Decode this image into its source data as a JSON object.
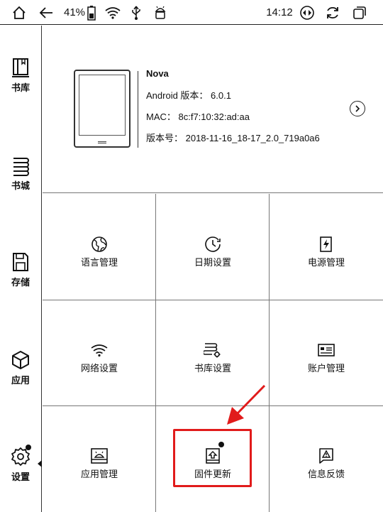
{
  "status_bar": {
    "battery": "41%",
    "time": "14:12",
    "icons": [
      "home-icon",
      "back-icon",
      "battery-icon",
      "wifi-icon",
      "usb-icon",
      "android-icon",
      "rotate-icon",
      "refresh-icon",
      "multitask-icon"
    ]
  },
  "sidebar": {
    "items": [
      {
        "label": "书库",
        "icon": "bookshelf-icon"
      },
      {
        "label": "书城",
        "icon": "bookstore-icon"
      },
      {
        "label": "存储",
        "icon": "storage-icon"
      },
      {
        "label": "应用",
        "icon": "apps-icon"
      },
      {
        "label": "设置",
        "icon": "settings-icon"
      }
    ],
    "active": "设置"
  },
  "device": {
    "name": "Nova",
    "android_line": "Android 版本： 6.0.1",
    "mac_line": "MAC： 8c:f7:10:32:ad:aa",
    "build_line": "版本号： 2018-11-16_18-17_2.0_719a0a6"
  },
  "tiles": [
    {
      "label": "语言管理",
      "icon": "globe-icon"
    },
    {
      "label": "日期设置",
      "icon": "clock-icon"
    },
    {
      "label": "电源管理",
      "icon": "power-icon"
    },
    {
      "label": "网络设置",
      "icon": "wifi-icon"
    },
    {
      "label": "书库设置",
      "icon": "library-settings-icon"
    },
    {
      "label": "账户管理",
      "icon": "account-card-icon"
    },
    {
      "label": "应用管理",
      "icon": "app-manage-icon"
    },
    {
      "label": "固件更新",
      "icon": "firmware-update-icon"
    },
    {
      "label": "信息反馈",
      "icon": "feedback-icon"
    }
  ],
  "annotation": {
    "color": "#e11b1b",
    "highlighted_tile": "固件更新"
  }
}
